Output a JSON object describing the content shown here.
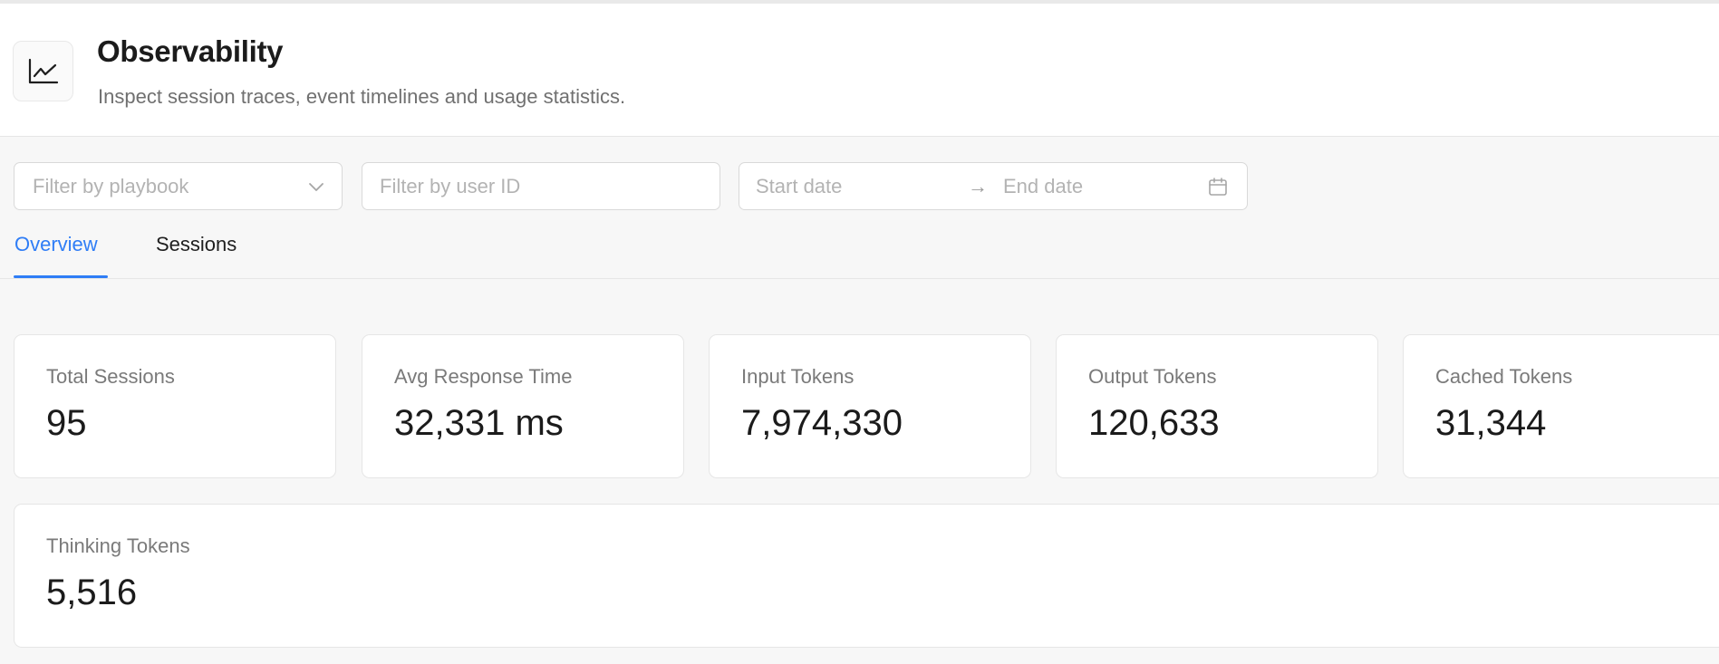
{
  "header": {
    "icon": "line-chart-icon",
    "title": "Observability",
    "subtitle": "Inspect session traces, event timelines and usage statistics."
  },
  "filters": {
    "playbook_placeholder": "Filter by playbook",
    "user_placeholder": "Filter by user ID",
    "start_date_placeholder": "Start date",
    "end_date_placeholder": "End date",
    "separator": "→"
  },
  "tabs": [
    {
      "label": "Overview",
      "active": true
    },
    {
      "label": "Sessions",
      "active": false
    }
  ],
  "stats": [
    {
      "label": "Total Sessions",
      "value": "95"
    },
    {
      "label": "Avg Response Time",
      "value": "32,331 ms"
    },
    {
      "label": "Input Tokens",
      "value": "7,974,330"
    },
    {
      "label": "Output Tokens",
      "value": "120,633"
    },
    {
      "label": "Cached Tokens",
      "value": "31,344"
    },
    {
      "label": "Thinking Tokens",
      "value": "5,516"
    }
  ],
  "colors": {
    "accent": "#2f7df6",
    "background": "#f7f7f7",
    "card": "#ffffff",
    "border": "#e6e6e6"
  }
}
